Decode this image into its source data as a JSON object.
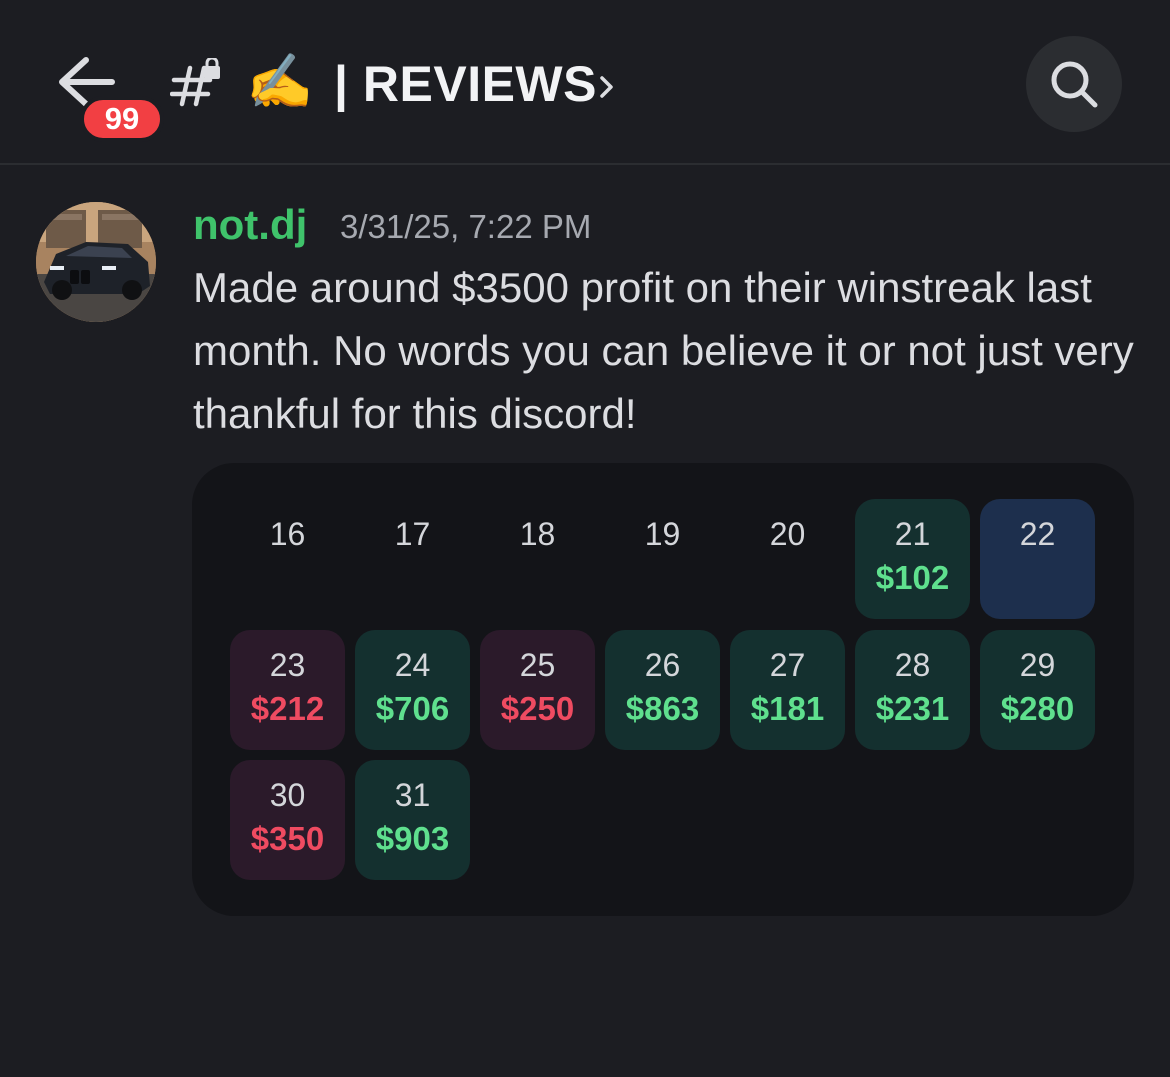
{
  "header": {
    "back_label": "Back",
    "unread_badge": "99",
    "channel_emoji": "✍️",
    "channel_title": "| REVIEWS"
  },
  "message": {
    "username": "not.dj",
    "timestamp": "3/31/25, 7:22 PM",
    "text": "Made around $3500 profit on their winstreak last month. No words you can believe it or not just very thankful for this discord!"
  },
  "calendar": {
    "cells": [
      {
        "day": "16",
        "amount": "",
        "status": "none"
      },
      {
        "day": "17",
        "amount": "",
        "status": "none"
      },
      {
        "day": "18",
        "amount": "",
        "status": "none"
      },
      {
        "day": "19",
        "amount": "",
        "status": "none"
      },
      {
        "day": "20",
        "amount": "",
        "status": "none"
      },
      {
        "day": "21",
        "amount": "$102",
        "status": "profit"
      },
      {
        "day": "22",
        "amount": "",
        "status": "today"
      },
      {
        "day": "23",
        "amount": "$212",
        "status": "loss"
      },
      {
        "day": "24",
        "amount": "$706",
        "status": "profit"
      },
      {
        "day": "25",
        "amount": "$250",
        "status": "loss"
      },
      {
        "day": "26",
        "amount": "$863",
        "status": "profit"
      },
      {
        "day": "27",
        "amount": "$181",
        "status": "profit"
      },
      {
        "day": "28",
        "amount": "$231",
        "status": "profit"
      },
      {
        "day": "29",
        "amount": "$280",
        "status": "profit"
      },
      {
        "day": "30",
        "amount": "$350",
        "status": "loss"
      },
      {
        "day": "31",
        "amount": "$903",
        "status": "profit"
      }
    ]
  },
  "colors": {
    "background": "#1c1d22",
    "username": "#3fc36b",
    "profit_text": "#5fe08e",
    "loss_text": "#ef4b61",
    "badge": "#f23f43"
  },
  "icons": {
    "back": "arrow-left-icon",
    "channel": "hash-lock-icon",
    "chevron": "chevron-right-icon",
    "search": "search-icon"
  }
}
